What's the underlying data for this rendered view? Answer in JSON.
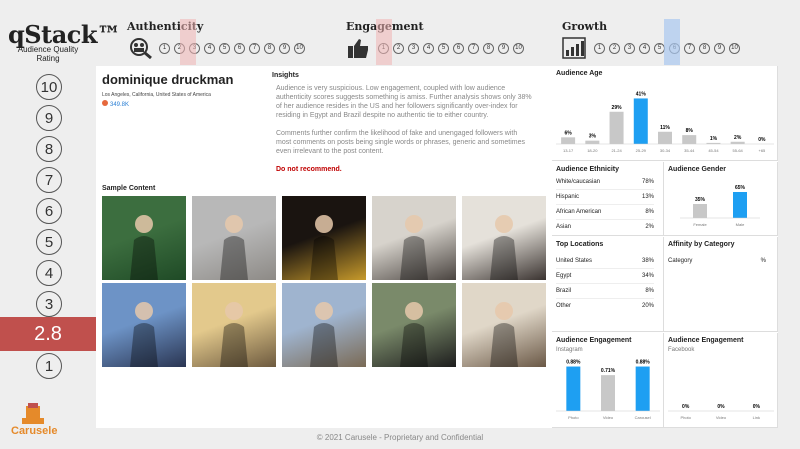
{
  "brand": {
    "name": "qStack™",
    "subtitle_line1": "Audience Quality",
    "subtitle_line2": "Rating"
  },
  "scale": [
    "10",
    "9",
    "8",
    "7",
    "6",
    "5",
    "4",
    "3",
    "2.8",
    "1"
  ],
  "score": "2.8",
  "logo_text": "Carusele",
  "headers": [
    {
      "title": "Authenticity",
      "icon": "magnifier-people-icon",
      "nums": [
        "1",
        "2",
        "3",
        "4",
        "5",
        "6",
        "7",
        "8",
        "9",
        "10"
      ]
    },
    {
      "title": "Engagement",
      "icon": "thumbs-up-icon",
      "nums": [
        "1",
        "2",
        "3",
        "4",
        "5",
        "6",
        "7",
        "8",
        "9",
        "10"
      ]
    },
    {
      "title": "Growth",
      "icon": "bar-growth-icon",
      "nums": [
        "1",
        "2",
        "3",
        "4",
        "5",
        "6",
        "7",
        "8",
        "9",
        "10"
      ]
    }
  ],
  "profile": {
    "name": "dominique druckman",
    "location": "Los Angeles, California, United States of America",
    "followers": "349.8K"
  },
  "insights": {
    "title": "Insights",
    "p1": "Audience is very suspicious. Low engagement, coupled with low audience authenticity scores suggests something is amiss. Further analysis shows only 38% of her audience resides in the US and her followers significantly over-index for residing in Egypt and Brazil despite no authentic tie to either country.",
    "p2": "Comments further confirm the likelihood of fake and unengaged followers with most comments on posts being single words or phrases, generic and sometimes even irrelevant to the post content.",
    "recommendation": "Do not recommend."
  },
  "sample_title": "Sample Content",
  "colors": {
    "accent": "#1e9ff2",
    "gray_bar": "#c8c8c8",
    "score_band": "#c0504d"
  },
  "chart_data": [
    {
      "type": "bar",
      "title": "Audience Age",
      "categories": [
        "13-17",
        "18-20",
        "21-24",
        "25-29",
        "30-34",
        "35-44",
        "45-54",
        "55-64",
        "+65"
      ],
      "values": [
        6,
        3,
        29,
        41,
        11,
        8,
        1,
        2,
        0
      ],
      "labels": [
        "6%",
        "3%",
        "29%",
        "41%",
        "11%",
        "8%",
        "1%",
        "2%",
        "0%"
      ],
      "highlight_index": 3,
      "ylim": [
        0,
        45
      ]
    },
    {
      "type": "bar",
      "title": "Audience Gender",
      "categories": [
        "Female",
        "Male"
      ],
      "values": [
        35,
        65
      ],
      "labels": [
        "35%",
        "65%"
      ],
      "highlight_index": 1,
      "ylim": [
        0,
        70
      ]
    },
    {
      "type": "bar",
      "title": "Audience Engagement",
      "subtitle": "Instagram",
      "categories": [
        "Photo",
        "Video",
        "Carousel"
      ],
      "values": [
        0.88,
        0.71,
        0.88
      ],
      "labels": [
        "0.88%",
        "0.71%",
        "0.88%"
      ],
      "highlight_indices": [
        0,
        2
      ],
      "ylim": [
        0,
        0.95
      ]
    },
    {
      "type": "bar",
      "title": "Audience Engagement",
      "subtitle": "Facebook",
      "categories": [
        "Photo",
        "Video",
        "Link"
      ],
      "values": [
        0,
        0,
        0
      ],
      "labels": [
        "0%",
        "0%",
        "0%"
      ],
      "highlight_indices": [],
      "ylim": [
        0,
        1
      ]
    }
  ],
  "ethnicity": {
    "title": "Audience Ethnicity",
    "rows": [
      [
        "White/caucasian",
        "78%"
      ],
      [
        "Hispanic",
        "13%"
      ],
      [
        "African American",
        "8%"
      ],
      [
        "Asian",
        "2%"
      ]
    ]
  },
  "locations": {
    "title": "Top Locations",
    "rows": [
      [
        "United States",
        "38%"
      ],
      [
        "Egypt",
        "34%"
      ],
      [
        "Brazil",
        "8%"
      ],
      [
        "Other",
        "20%"
      ]
    ]
  },
  "affinity": {
    "title": "Affinity by Category",
    "col1": "Category",
    "col2": "%"
  },
  "footer": "© 2021 Carusele - Proprietary and Confidential"
}
